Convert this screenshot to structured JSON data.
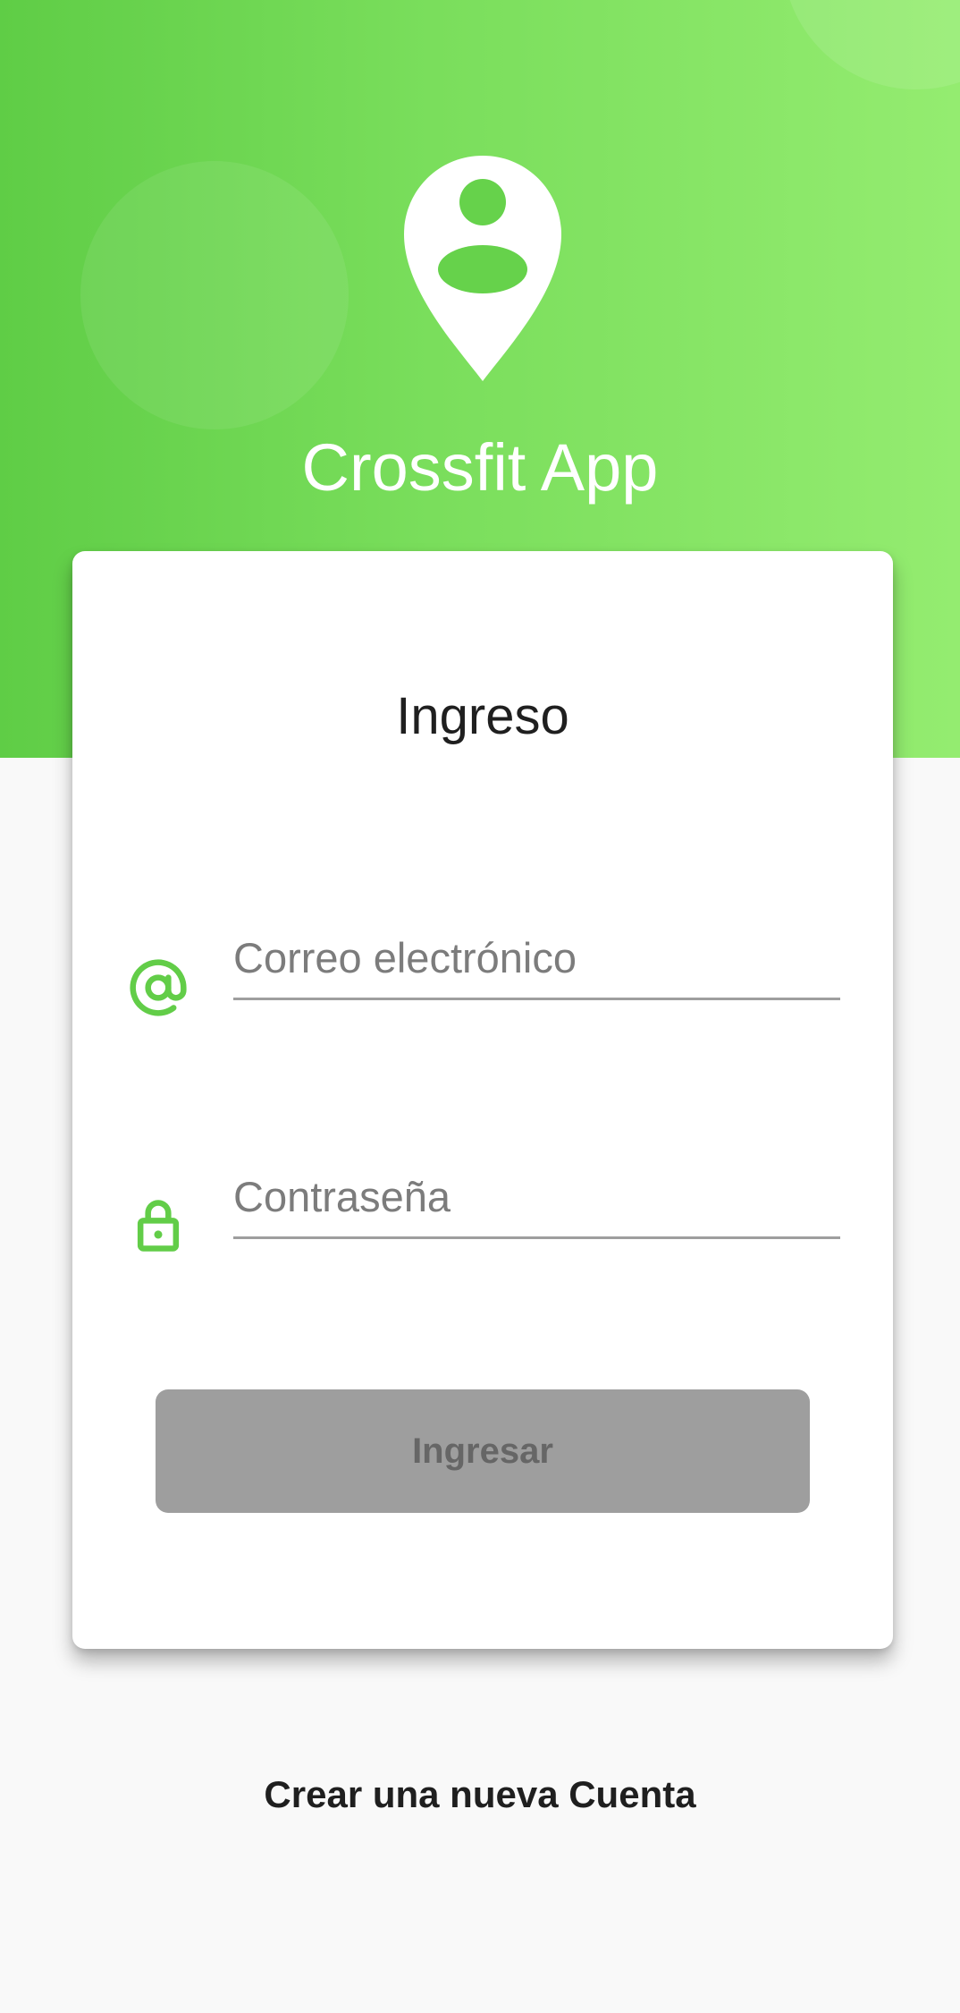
{
  "header": {
    "app_title": "Crossfit App",
    "logo_icon": "user-location-pin-icon",
    "gradient_start": "#5fcd46",
    "gradient_end": "#94ec70"
  },
  "login_card": {
    "title": "Ingreso",
    "email": {
      "icon": "at-sign-icon",
      "placeholder": "Correo electrónico",
      "value": ""
    },
    "password": {
      "icon": "lock-icon",
      "placeholder": "Contraseña",
      "value": ""
    },
    "submit_label": "Ingresar"
  },
  "footer": {
    "create_account_label": "Crear una nueva Cuenta"
  },
  "colors": {
    "accent": "#5fcd46",
    "disabled_button": "#9e9e9e"
  }
}
